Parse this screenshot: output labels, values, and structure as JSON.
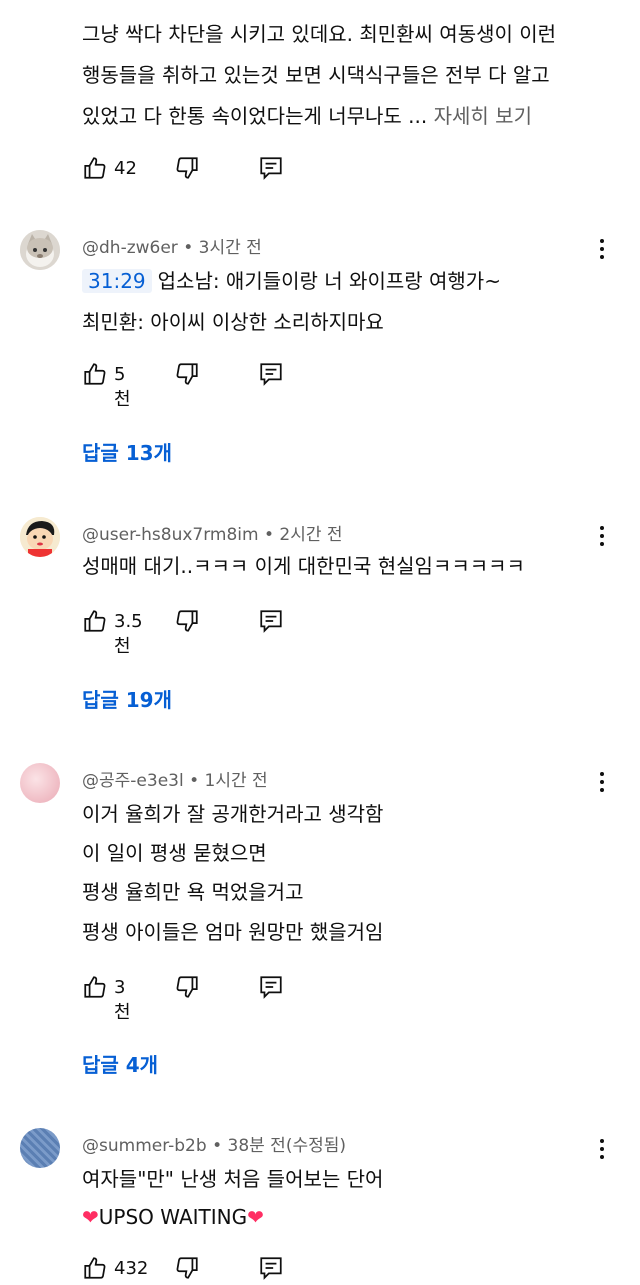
{
  "comment0": {
    "lines": [
      "그냥 싹다 차단을 시키고 있데요. 최민환씨 여동생이 이런",
      "행동들을 취하고 있는것 보면 시댁식구들은 전부 다 알고",
      "있었고 다 한통 속이었다는게 너무나도 ..."
    ],
    "more_label": "자세히 보기",
    "likes": "42"
  },
  "comment1": {
    "author": "@dh-zw6er",
    "time": "3시간 전",
    "timestamp_link": "31:29",
    "line1_rest": "업소남: 애기들이랑 너 와이프랑 여행가~",
    "line2": "최민환: 아이씨 이상한 소리하지마요",
    "likes": "5천",
    "replies": "답글 13개"
  },
  "comment2": {
    "author": "@user-hs8ux7rm8im",
    "time": "2시간 전",
    "line1": "성매매 대기..ㅋㅋㅋ 이게 대한민국 현실임ㅋㅋㅋㅋㅋ",
    "likes": "3.5천",
    "replies": "답글 19개"
  },
  "comment3": {
    "author": "@공주-e3e3l",
    "time": "1시간 전",
    "lines": [
      "이거 율희가 잘 공개한거라고 생각함",
      "이 일이 평생 묻혔으면",
      "평생 율희만 욕 먹었을거고",
      "평생 아이들은 엄마 원망만 했을거임"
    ],
    "likes": "3천",
    "replies": "답글 4개"
  },
  "comment4": {
    "author": "@summer-b2b",
    "time": "38분 전(수정됨)",
    "line1": "여자들\"만\" 난생 처음 들어보는 단어",
    "line2": "UPSO WAITING",
    "heart": "❤",
    "likes": "432"
  },
  "separator": "•",
  "icons": {
    "like": "thumb-up-icon",
    "dislike": "thumb-down-icon",
    "reply": "comment-icon",
    "menu": "more-vert-icon"
  },
  "colors": {
    "link": "#065fd4",
    "meta": "#606060",
    "text": "#0f0f0f"
  }
}
